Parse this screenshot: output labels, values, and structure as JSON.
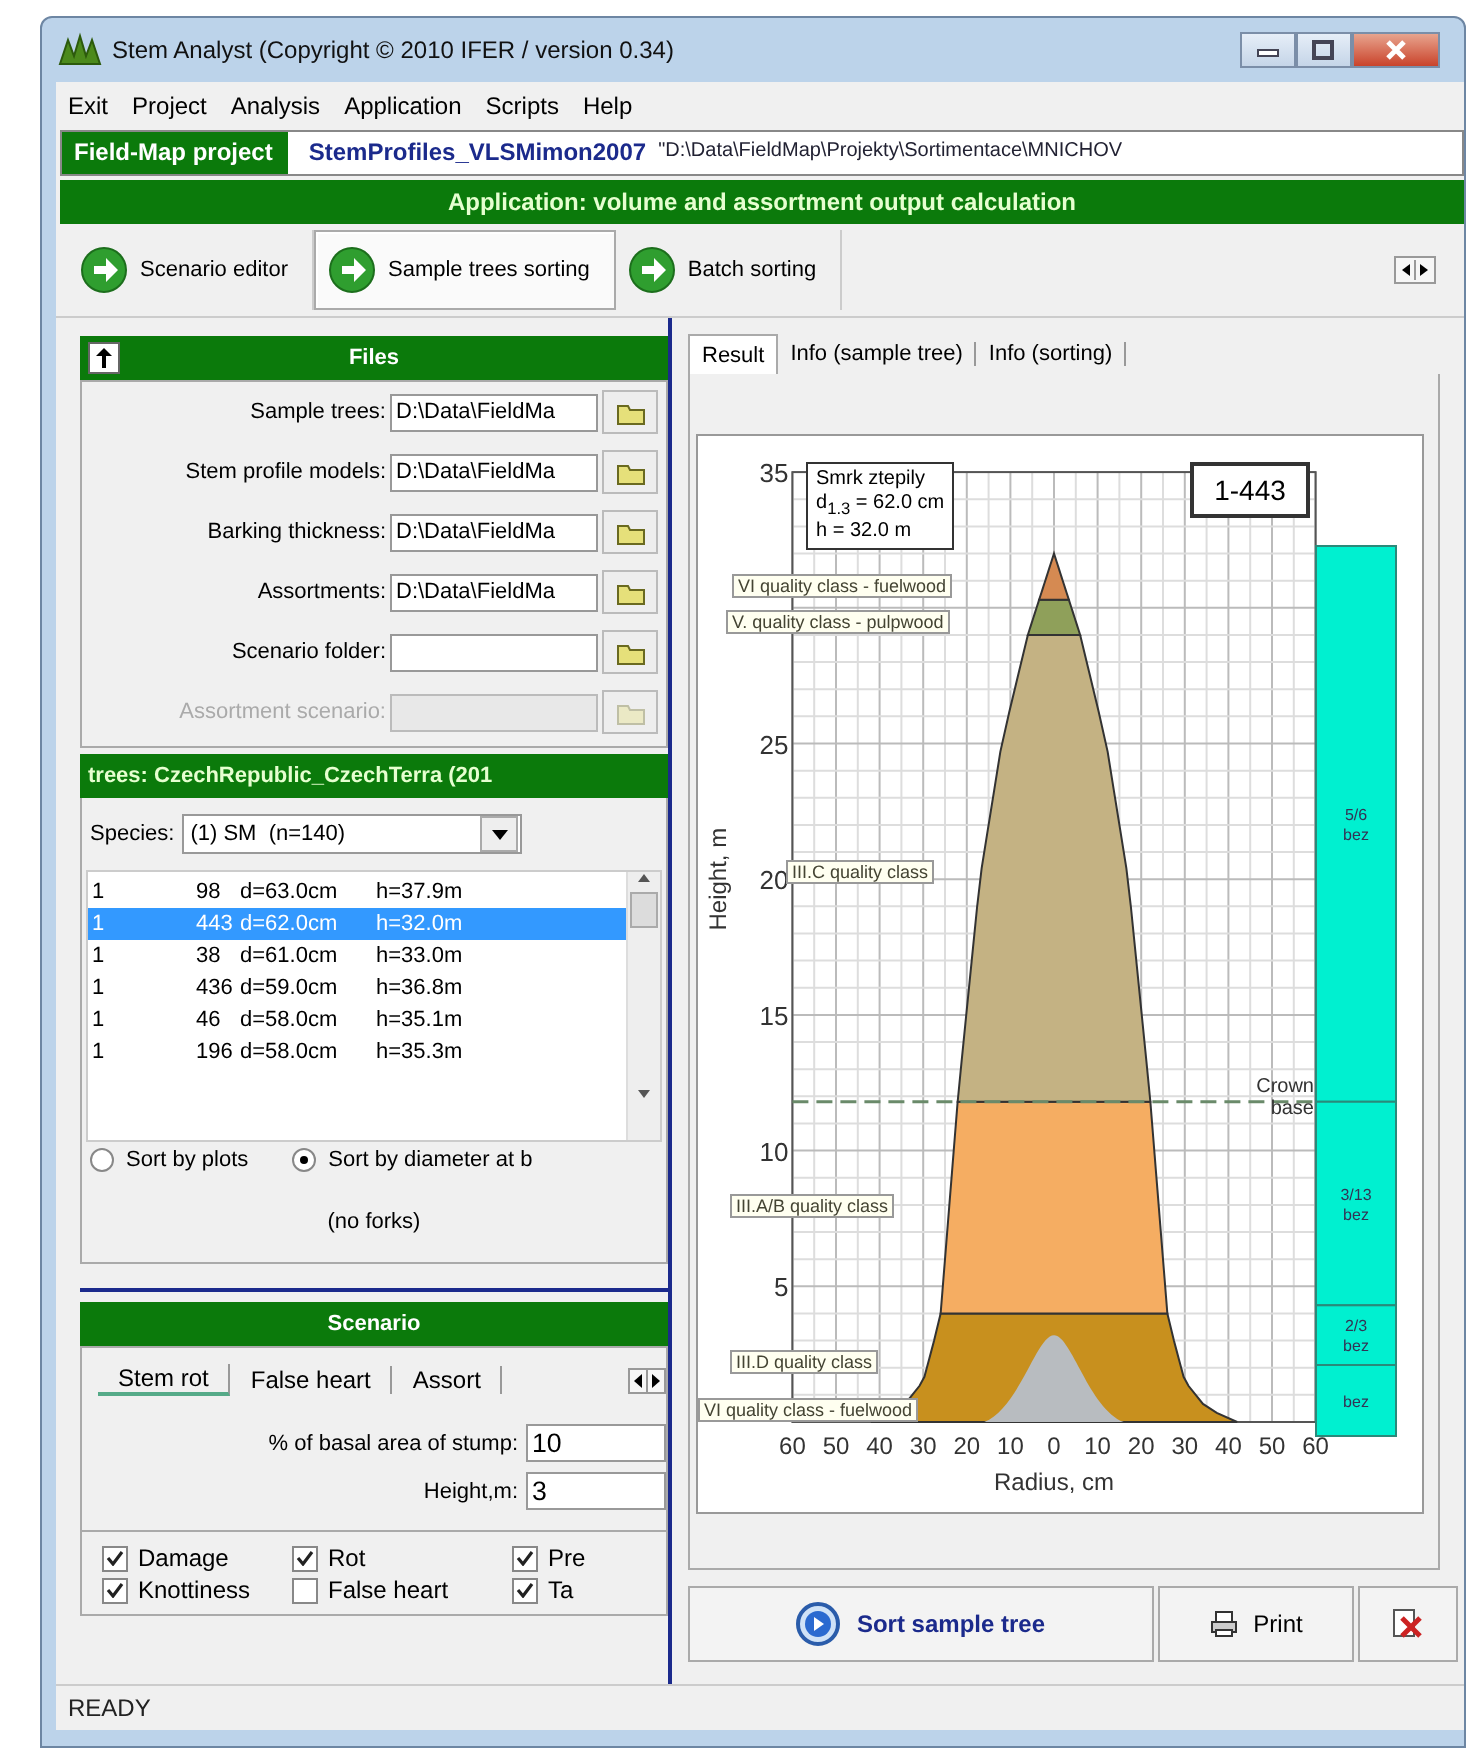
{
  "window": {
    "title": "Stem Analyst (Copyright © 2010 IFER / version 0.34)"
  },
  "menu": [
    "Exit",
    "Project",
    "Analysis",
    "Application",
    "Scripts",
    "Help"
  ],
  "project_bar": {
    "label": "Field-Map project",
    "name": "StemProfiles_VLSMimon2007",
    "path": "\"D:\\Data\\FieldMap\\Projekty\\Sortimentace\\MNICHOV"
  },
  "app_banner": "Application: volume and assortment output calculation",
  "toolbar_tabs": [
    {
      "label": "Scenario editor",
      "selected": false
    },
    {
      "label": "Sample trees sorting",
      "selected": true
    },
    {
      "label": "Batch sorting",
      "selected": false
    }
  ],
  "files": {
    "title": "Files",
    "fields": [
      {
        "label": "Sample trees:",
        "value": "D:\\Data\\FieldMa",
        "disabled": false
      },
      {
        "label": "Stem profile models:",
        "value": "D:\\Data\\FieldMa",
        "disabled": false
      },
      {
        "label": "Barking thickness:",
        "value": "D:\\Data\\FieldMa",
        "disabled": false
      },
      {
        "label": "Assortments:",
        "value": "D:\\Data\\FieldMa",
        "disabled": false
      },
      {
        "label": "Scenario folder:",
        "disabled": false
      },
      {
        "label": "Assortment scenario:",
        "disabled": true
      }
    ]
  },
  "trees": {
    "title": "trees: CzechRepublic_CzechTerra (201",
    "species": {
      "label": "Species:",
      "value": "(1) SM  (n=140)"
    },
    "rows": [
      {
        "cells": [
          "1",
          "98",
          "d=63.0cm",
          "h=37.9m"
        ],
        "selected": false
      },
      {
        "cells": [
          "1",
          "443",
          "d=62.0cm",
          "h=32.0m"
        ],
        "selected": true
      },
      {
        "cells": [
          "1",
          "38",
          "d=61.0cm",
          "h=33.0m"
        ],
        "selected": false
      },
      {
        "cells": [
          "1",
          "436",
          "d=59.0cm",
          "h=36.8m"
        ],
        "selected": false
      },
      {
        "cells": [
          "1",
          "46",
          "d=58.0cm",
          "h=35.1m"
        ],
        "selected": false
      },
      {
        "cells": [
          "1",
          "196",
          "d=58.0cm",
          "h=35.3m"
        ],
        "selected": false
      }
    ],
    "sort_options": [
      {
        "label": "Sort by plots",
        "selected": false
      },
      {
        "label": "Sort by diameter at b",
        "selected": true
      }
    ],
    "note": "(no forks)"
  },
  "scenario": {
    "title": "Scenario",
    "tabs": [
      {
        "label": "Stem rot",
        "selected": true
      },
      {
        "label": "False heart",
        "selected": false
      },
      {
        "label": "Assort",
        "selected": false
      }
    ],
    "fields": [
      {
        "label": "% of basal area of stump:",
        "value": "10"
      },
      {
        "label": "Height,m:",
        "value": "3"
      }
    ],
    "checks": [
      {
        "label": "Damage",
        "checked": true
      },
      {
        "label": "Rot",
        "checked": true
      },
      {
        "label": "Pre",
        "checked": true
      },
      {
        "label": "Knottiness",
        "checked": true
      },
      {
        "label": "False heart",
        "checked": false
      },
      {
        "label": "Ta",
        "checked": true
      }
    ]
  },
  "result_tabs": [
    {
      "label": "Result",
      "selected": true
    },
    {
      "label": "Info (sample tree)",
      "selected": false
    },
    {
      "label": "Info (sorting)",
      "selected": false
    }
  ],
  "profile": {
    "info": [
      "Smrk ztepily",
      "d$_{1.3}$ = 62.0 cm",
      "h = 32.0 m"
    ],
    "tree_id": "1-443",
    "yticks": [
      "35",
      "25",
      "20",
      "15",
      "10",
      "5"
    ],
    "xticks": [
      "60",
      "50",
      "40",
      "30",
      "20",
      "10",
      "0",
      "10",
      "20",
      "30",
      "40",
      "50",
      "60"
    ],
    "xlabel": "Radius, cm",
    "ylabel": "Height, m",
    "crown_label": "Crown base",
    "sections": [
      {
        "kind": "band",
        "color": "#c8901e"
      },
      {
        "kind": "band",
        "color": "#f5ad62"
      },
      {
        "kind": "band",
        "color": "#c4b283"
      },
      {
        "kind": "band",
        "color": "#8fa05a"
      },
      {
        "kind": "band",
        "color": "#d58a52"
      },
      {
        "kind": "rot",
        "color": "#b8bcc0"
      }
    ],
    "section_labels": [
      "VI quality class - fuelwood",
      "V. quality class - pulpwood",
      "III.C quality class",
      "III.A/B quality class",
      "III.D quality class",
      "VI quality class - fuelwood"
    ],
    "bar": [
      {
        "lines": [
          "5/6",
          "bez"
        ]
      },
      {
        "lines": [
          "3/13",
          "bez"
        ]
      },
      {
        "lines": [
          "2/3",
          "bez"
        ]
      },
      {
        "lines": [
          "bez"
        ]
      }
    ]
  },
  "buttons": {
    "sort": "Sort sample tree",
    "print": "Print"
  },
  "status": "READY"
}
